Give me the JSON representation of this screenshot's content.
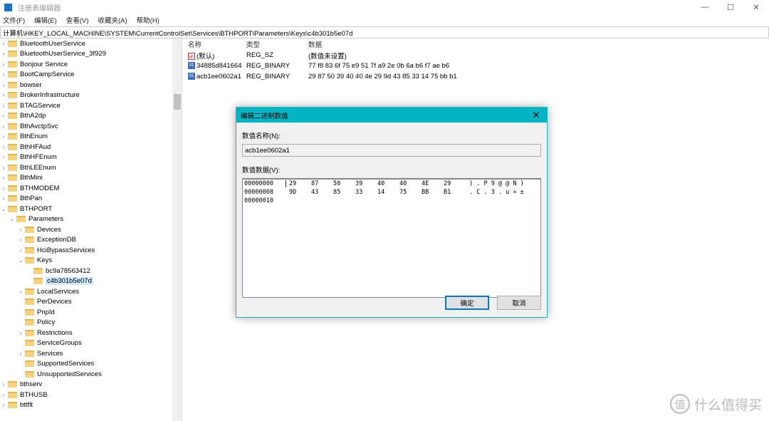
{
  "window": {
    "title": "注册表编辑器",
    "minimize": "—",
    "maximize": "☐",
    "close": "✕"
  },
  "menu": [
    "文件(F)",
    "编辑(E)",
    "查看(V)",
    "收藏夹(A)",
    "帮助(H)"
  ],
  "address": "计算机\\HKEY_LOCAL_MACHINE\\SYSTEM\\CurrentControlSet\\Services\\BTHPORT\\Parameters\\Keys\\c4b301b5e07d",
  "tree": [
    {
      "label": "BluetoothUserService",
      "level": 0,
      "arrow": ">"
    },
    {
      "label": "BluetoothUserService_3f929",
      "level": 0,
      "arrow": ">"
    },
    {
      "label": "Bonjour Service",
      "level": 0,
      "arrow": ">"
    },
    {
      "label": "BootCampService",
      "level": 0,
      "arrow": ">"
    },
    {
      "label": "bowser",
      "level": 0,
      "arrow": ">"
    },
    {
      "label": "BrokerInfrastructure",
      "level": 0,
      "arrow": ">"
    },
    {
      "label": "BTAGService",
      "level": 0,
      "arrow": ">"
    },
    {
      "label": "BthA2dp",
      "level": 0,
      "arrow": ">"
    },
    {
      "label": "BthAvctpSvc",
      "level": 0,
      "arrow": ">"
    },
    {
      "label": "BthEnum",
      "level": 0,
      "arrow": ">"
    },
    {
      "label": "BthHFAud",
      "level": 0,
      "arrow": ">"
    },
    {
      "label": "BthHFEnum",
      "level": 0,
      "arrow": ">"
    },
    {
      "label": "BthLEEnum",
      "level": 0,
      "arrow": ">"
    },
    {
      "label": "BthMini",
      "level": 0,
      "arrow": ">"
    },
    {
      "label": "BTHMODEM",
      "level": 0,
      "arrow": ">"
    },
    {
      "label": "BthPan",
      "level": 0,
      "arrow": ">"
    },
    {
      "label": "BTHPORT",
      "level": 0,
      "arrow": "v"
    },
    {
      "label": "Parameters",
      "level": 1,
      "arrow": "v"
    },
    {
      "label": "Devices",
      "level": 2,
      "arrow": ">"
    },
    {
      "label": "ExceptionDB",
      "level": 2,
      "arrow": ">"
    },
    {
      "label": "HciBypassServices",
      "level": 2,
      "arrow": ">"
    },
    {
      "label": "Keys",
      "level": 2,
      "arrow": "v"
    },
    {
      "label": "bc9a78563412",
      "level": 3,
      "arrow": ""
    },
    {
      "label": "c4b301b5e07d",
      "level": 3,
      "arrow": "",
      "selected": true
    },
    {
      "label": "LocalServices",
      "level": 2,
      "arrow": ">"
    },
    {
      "label": "PerDevices",
      "level": 2,
      "arrow": ""
    },
    {
      "label": "PnpId",
      "level": 2,
      "arrow": ""
    },
    {
      "label": "Policy",
      "level": 2,
      "arrow": ""
    },
    {
      "label": "Restrictions",
      "level": 2,
      "arrow": ">"
    },
    {
      "label": "ServiceGroups",
      "level": 2,
      "arrow": ""
    },
    {
      "label": "Services",
      "level": 2,
      "arrow": ">"
    },
    {
      "label": "SupportedServices",
      "level": 2,
      "arrow": ""
    },
    {
      "label": "UnsupportedServices",
      "level": 2,
      "arrow": ""
    },
    {
      "label": "bthserv",
      "level": 0,
      "arrow": ">"
    },
    {
      "label": "BTHUSB",
      "level": 0,
      "arrow": ">"
    },
    {
      "label": "bttflt",
      "level": 0,
      "arrow": ">"
    }
  ],
  "list": {
    "headers": [
      "名称",
      "类型",
      "数据"
    ],
    "rows": [
      {
        "icon": "string-value-icon",
        "name": "(默认)",
        "type": "REG_SZ",
        "data": "(数值未设置)"
      },
      {
        "icon": "binary-value-icon",
        "name": "34885d841664",
        "type": "REG_BINARY",
        "data": "77 f8 83 6f 75 e9 51 7f a9 2e 0b 6a b6 f7 ae b6"
      },
      {
        "icon": "binary-value-icon",
        "name": "acb1ee0602a1",
        "type": "REG_BINARY",
        "data": "29 87 50 39 40 40 4e 29 9d 43 85 33 14 75 bb b1"
      }
    ]
  },
  "dialog": {
    "title": "编辑二进制数值",
    "close": "✕",
    "name_label": "数值名称(N):",
    "name_value": "acb1ee0602a1",
    "data_label": "数值数据(V):",
    "hex_rows": [
      {
        "addr": "00000000",
        "bytes": [
          "29",
          "87",
          "50",
          "39",
          "40",
          "40",
          "4E",
          "29"
        ],
        "ascii": ") . P 9 @ @ N )"
      },
      {
        "addr": "00000008",
        "bytes": [
          "9D",
          "43",
          "85",
          "33",
          "14",
          "75",
          "BB",
          "B1"
        ],
        "ascii": ". C . 3 . u » ±"
      },
      {
        "addr": "00000010",
        "bytes": [],
        "ascii": ""
      }
    ],
    "ok": "确定",
    "cancel": "取消"
  },
  "watermark": {
    "logo": "值",
    "text": "什么值得买"
  },
  "colors": {
    "dialog_title": "#00b4c4",
    "folder": "#f6d37a",
    "selection": "#cce8ff"
  }
}
